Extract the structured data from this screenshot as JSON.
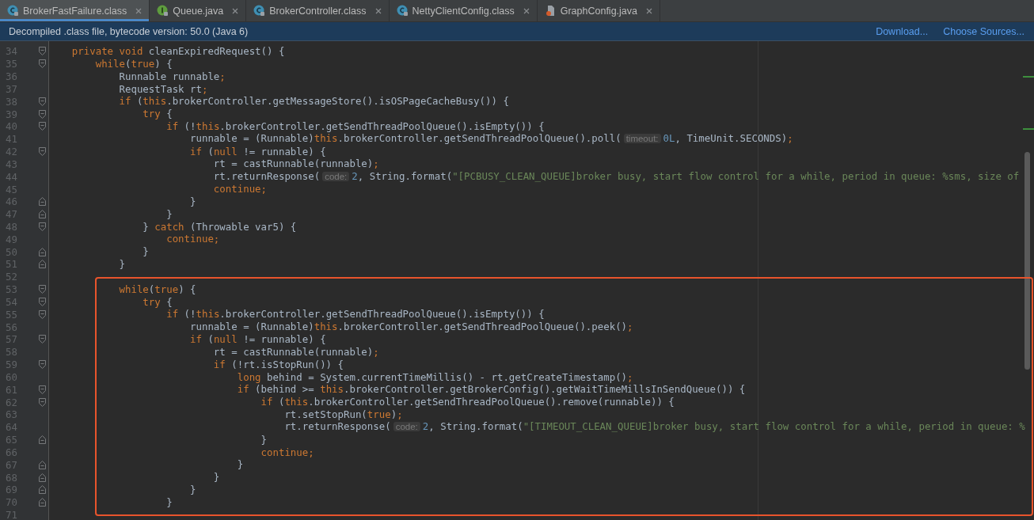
{
  "tabs": [
    {
      "label": "BrokerFastFailure.class",
      "kind": "class",
      "selected": true
    },
    {
      "label": "Queue.java",
      "kind": "interface",
      "selected": false
    },
    {
      "label": "BrokerController.class",
      "kind": "class",
      "selected": false
    },
    {
      "label": "NettyClientConfig.class",
      "kind": "class",
      "selected": false
    },
    {
      "label": "GraphConfig.java",
      "kind": "java-file",
      "selected": false
    }
  ],
  "banner": {
    "message": "Decompiled .class file, bytecode version: 50.0 (Java 6)",
    "links": [
      "Download...",
      "Choose Sources..."
    ]
  },
  "blocks": [
    {
      "highlighted": false,
      "lines": [
        {
          "number": "34",
          "kind": "block-start",
          "code": [
            {
              "kind": "keyword",
              "s": "    private void"
            },
            {
              "kind": "plain",
              "s": " cleanExpiredRequest() {"
            }
          ]
        },
        {
          "number": "35",
          "kind": "block-start",
          "code": [
            {
              "kind": "keyword",
              "s": "        while"
            },
            {
              "kind": "plain",
              "s": "("
            },
            {
              "kind": "keyword",
              "s": "true"
            },
            {
              "kind": "plain",
              "s": ") {"
            }
          ]
        },
        {
          "number": "36",
          "kind": "plain",
          "code": [
            {
              "kind": "plain",
              "s": "            Runnable runnable"
            },
            {
              "kind": "keyword",
              "s": ";"
            }
          ]
        },
        {
          "number": "37",
          "kind": "plain",
          "code": [
            {
              "kind": "plain",
              "s": "            RequestTask rt"
            },
            {
              "kind": "keyword",
              "s": ";"
            }
          ]
        },
        {
          "number": "38",
          "kind": "block-start",
          "code": [
            {
              "kind": "keyword",
              "s": "            if"
            },
            {
              "kind": "plain",
              "s": " ("
            },
            {
              "kind": "keyword",
              "s": "this"
            },
            {
              "kind": "plain",
              "s": ".brokerController.getMessageStore().isOSPageCacheBusy()) {"
            }
          ]
        },
        {
          "number": "39",
          "kind": "block-start",
          "code": [
            {
              "kind": "keyword",
              "s": "                try"
            },
            {
              "kind": "plain",
              "s": " {"
            }
          ]
        },
        {
          "number": "40",
          "kind": "block-start",
          "code": [
            {
              "kind": "keyword",
              "s": "                    if"
            },
            {
              "kind": "plain",
              "s": " (!"
            },
            {
              "kind": "keyword",
              "s": "this"
            },
            {
              "kind": "plain",
              "s": ".brokerController.getSendThreadPoolQueue().isEmpty()) {"
            }
          ]
        },
        {
          "number": "41",
          "kind": "plain",
          "code": [
            {
              "kind": "plain",
              "s": "                        runnable = (Runnable)"
            },
            {
              "kind": "keyword",
              "s": "this"
            },
            {
              "kind": "plain",
              "s": ".brokerController.getSendThreadPoolQueue().poll("
            },
            {
              "kind": "hint",
              "s": "timeout:"
            },
            {
              "kind": "number",
              "s": "0L"
            },
            {
              "kind": "plain",
              "s": ", TimeUnit.SECONDS)"
            },
            {
              "kind": "keyword",
              "s": ";"
            }
          ]
        },
        {
          "number": "42",
          "kind": "block-start",
          "code": [
            {
              "kind": "keyword",
              "s": "                        if"
            },
            {
              "kind": "plain",
              "s": " ("
            },
            {
              "kind": "keyword",
              "s": "null"
            },
            {
              "kind": "plain",
              "s": " != runnable) {"
            }
          ]
        },
        {
          "number": "43",
          "kind": "plain",
          "code": [
            {
              "kind": "plain",
              "s": "                            rt = castRunnable(runnable)"
            },
            {
              "kind": "keyword",
              "s": ";"
            }
          ]
        },
        {
          "number": "44",
          "kind": "plain",
          "code": [
            {
              "kind": "plain",
              "s": "                            rt.returnResponse("
            },
            {
              "kind": "hint",
              "s": "code:"
            },
            {
              "kind": "number",
              "s": "2"
            },
            {
              "kind": "plain",
              "s": ", String.format("
            },
            {
              "kind": "string",
              "s": "\"[PCBUSY_CLEAN_QUEUE]broker busy, start flow control for a while, period in queue: %sms, size of"
            }
          ]
        },
        {
          "number": "45",
          "kind": "plain",
          "code": [
            {
              "kind": "keyword",
              "s": "                            continue;"
            }
          ]
        },
        {
          "number": "46",
          "kind": "block-end",
          "code": [
            {
              "kind": "plain",
              "s": "                        }"
            }
          ]
        },
        {
          "number": "47",
          "kind": "block-end",
          "code": [
            {
              "kind": "plain",
              "s": "                    }"
            }
          ]
        },
        {
          "number": "48",
          "kind": "block-start",
          "code": [
            {
              "kind": "plain",
              "s": "                } "
            },
            {
              "kind": "keyword",
              "s": "catch"
            },
            {
              "kind": "plain",
              "s": " (Throwable var5) {"
            }
          ]
        },
        {
          "number": "49",
          "kind": "plain",
          "code": [
            {
              "kind": "keyword",
              "s": "                    continue;"
            }
          ]
        },
        {
          "number": "50",
          "kind": "block-end",
          "code": [
            {
              "kind": "plain",
              "s": "                }"
            }
          ]
        },
        {
          "number": "51",
          "kind": "block-end",
          "code": [
            {
              "kind": "plain",
              "s": "            }"
            }
          ]
        },
        {
          "number": "52",
          "kind": "plain"
        }
      ]
    },
    {
      "highlighted": true,
      "lines": [
        {
          "number": "53",
          "kind": "block-start",
          "code": [
            {
              "kind": "keyword",
              "s": "            while"
            },
            {
              "kind": "plain",
              "s": "("
            },
            {
              "kind": "keyword",
              "s": "true"
            },
            {
              "kind": "plain",
              "s": ") {"
            }
          ]
        },
        {
          "number": "54",
          "kind": "block-start",
          "code": [
            {
              "kind": "keyword",
              "s": "                try"
            },
            {
              "kind": "plain",
              "s": " {"
            }
          ]
        },
        {
          "number": "55",
          "kind": "block-start",
          "code": [
            {
              "kind": "keyword",
              "s": "                    if"
            },
            {
              "kind": "plain",
              "s": " (!"
            },
            {
              "kind": "keyword",
              "s": "this"
            },
            {
              "kind": "plain",
              "s": ".brokerController.getSendThreadPoolQueue().isEmpty()) {"
            }
          ]
        },
        {
          "number": "56",
          "kind": "plain",
          "code": [
            {
              "kind": "plain",
              "s": "                        runnable = (Runnable)"
            },
            {
              "kind": "keyword",
              "s": "this"
            },
            {
              "kind": "plain",
              "s": ".brokerController.getSendThreadPoolQueue().peek()"
            },
            {
              "kind": "keyword",
              "s": ";"
            }
          ]
        },
        {
          "number": "57",
          "kind": "block-start",
          "code": [
            {
              "kind": "keyword",
              "s": "                        if"
            },
            {
              "kind": "plain",
              "s": " ("
            },
            {
              "kind": "keyword",
              "s": "null"
            },
            {
              "kind": "plain",
              "s": " != runnable) {"
            }
          ]
        },
        {
          "number": "58",
          "kind": "plain",
          "code": [
            {
              "kind": "plain",
              "s": "                            rt = castRunnable(runnable)"
            },
            {
              "kind": "keyword",
              "s": ";"
            }
          ]
        },
        {
          "number": "59",
          "kind": "block-start",
          "code": [
            {
              "kind": "keyword",
              "s": "                            if"
            },
            {
              "kind": "plain",
              "s": " (!rt.isStopRun()) {"
            }
          ]
        },
        {
          "number": "60",
          "kind": "plain",
          "code": [
            {
              "kind": "keyword",
              "s": "                                long"
            },
            {
              "kind": "plain",
              "s": " behind = System.currentTimeMillis() - rt.getCreateTimestamp()"
            },
            {
              "kind": "keyword",
              "s": ";"
            }
          ]
        },
        {
          "number": "61",
          "kind": "block-start",
          "code": [
            {
              "kind": "keyword",
              "s": "                                if"
            },
            {
              "kind": "plain",
              "s": " (behind >= "
            },
            {
              "kind": "keyword",
              "s": "this"
            },
            {
              "kind": "plain",
              "s": ".brokerController.getBrokerConfig().getWaitTimeMillsInSendQueue()) {"
            }
          ]
        },
        {
          "number": "62",
          "kind": "block-start",
          "code": [
            {
              "kind": "keyword",
              "s": "                                    if"
            },
            {
              "kind": "plain",
              "s": " ("
            },
            {
              "kind": "keyword",
              "s": "this"
            },
            {
              "kind": "plain",
              "s": ".brokerController.getSendThreadPoolQueue().remove(runnable)) {"
            }
          ]
        },
        {
          "number": "63",
          "kind": "plain",
          "code": [
            {
              "kind": "plain",
              "s": "                                        rt.setStopRun("
            },
            {
              "kind": "keyword",
              "s": "true"
            },
            {
              "kind": "plain",
              "s": ")"
            },
            {
              "kind": "keyword",
              "s": ";"
            }
          ]
        },
        {
          "number": "64",
          "kind": "plain",
          "code": [
            {
              "kind": "plain",
              "s": "                                        rt.returnResponse("
            },
            {
              "kind": "hint",
              "s": "code:"
            },
            {
              "kind": "number",
              "s": "2"
            },
            {
              "kind": "plain",
              "s": ", String.format("
            },
            {
              "kind": "string",
              "s": "\"[TIMEOUT_CLEAN_QUEUE]broker busy, start flow control for a while, period in queue: %"
            }
          ]
        },
        {
          "number": "65",
          "kind": "block-end",
          "code": [
            {
              "kind": "plain",
              "s": "                                    }"
            }
          ]
        },
        {
          "number": "66",
          "kind": "plain",
          "code": [
            {
              "kind": "keyword",
              "s": "                                    continue;"
            }
          ]
        },
        {
          "number": "67",
          "kind": "block-end",
          "code": [
            {
              "kind": "plain",
              "s": "                                }"
            }
          ]
        },
        {
          "number": "68",
          "kind": "block-end",
          "code": [
            {
              "kind": "plain",
              "s": "                            }"
            }
          ]
        },
        {
          "number": "69",
          "kind": "block-end",
          "code": [
            {
              "kind": "plain",
              "s": "                        }"
            }
          ]
        },
        {
          "number": "70",
          "kind": "block-end",
          "code": [
            {
              "kind": "plain",
              "s": "                    }"
            }
          ]
        }
      ]
    },
    {
      "highlighted": false,
      "lines": [
        {
          "number": "71",
          "kind": "plain"
        }
      ]
    }
  ]
}
